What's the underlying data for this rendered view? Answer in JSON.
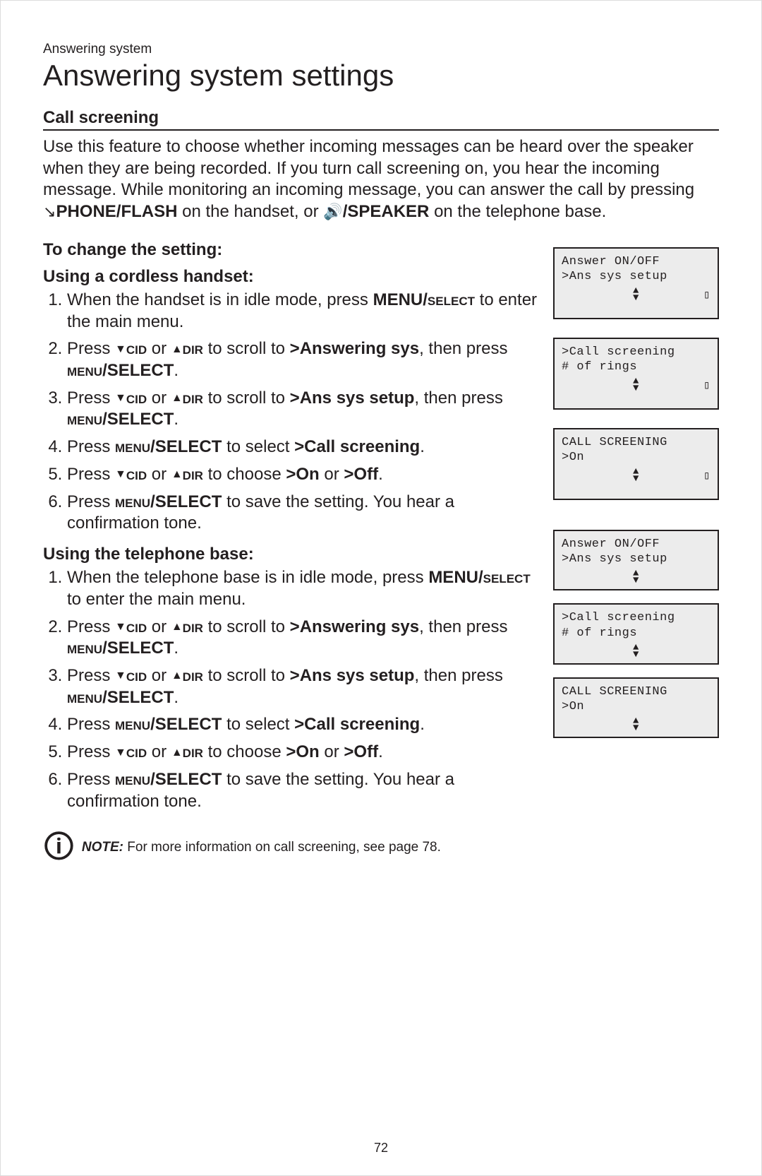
{
  "document": {
    "section_label": "Answering system",
    "title": "Answering system settings",
    "page_number": "72"
  },
  "call_screening": {
    "heading": "Call screening",
    "intro_before_phone": "Use this feature to choose whether incoming messages can be heard over the speaker when they are being recorded. If you turn call screening on, you hear the incoming message. While monitoring an incoming message, you can answer the call by pressing ",
    "phone_flash": "PHONE/FLASH",
    "intro_mid": " on the handset, or ",
    "speaker": "/SPEAKER",
    "intro_after": " on the telephone base."
  },
  "to_change": "To change the setting:",
  "cordless": {
    "heading": "Using a cordless handset:",
    "steps": [
      "When the handset is in idle mode, press MENU/SELECT to enter the main menu.",
      "Press ▼CID or ▲DIR to scroll to >Answering sys, then press MENU/SELECT.",
      "Press ▼CID or ▲DIR to scroll to >Ans sys setup, then press MENU/SELECT.",
      "Press MENU/SELECT to select >Call screening.",
      "Press ▼CID or ▲DIR to choose >On or >Off.",
      "Press MENU/SELECT to save the setting. You hear a confirmation tone."
    ]
  },
  "base": {
    "heading": "Using the telephone base:",
    "steps": [
      "When the telephone base is in idle mode, press MENU/SELECT to enter the main menu.",
      "Press ▼CID or ▲DIR to scroll to >Answering sys, then press MENU/SELECT.",
      "Press ▼CID or ▲DIR to scroll to >Ans sys setup, then press MENU/SELECT.",
      "Press MENU/SELECT to select >Call screening.",
      "Press ▼CID or ▲DIR to choose >On or >Off.",
      "Press MENU/SELECT to save the setting. You hear a confirmation tone."
    ]
  },
  "note": {
    "label": "NOTE:",
    "text": " For more information on call screening, see page 78."
  },
  "lcd_top": [
    {
      "line1": " Answer ON/OFF",
      "line2": ">Ans sys setup",
      "battery": true
    },
    {
      "line1": ">Call screening",
      "line2": " # of rings",
      "battery": true
    },
    {
      "line1": "CALL SCREENING",
      "line2": ">On",
      "battery": true
    }
  ],
  "lcd_bottom": [
    {
      "line1": " Answer ON/OFF",
      "line2": ">Ans sys setup",
      "battery": false
    },
    {
      "line1": ">Call screening",
      "line2": " # of rings",
      "battery": false
    },
    {
      "line1": "CALL SCREENING",
      "line2": ">On",
      "battery": false
    }
  ]
}
